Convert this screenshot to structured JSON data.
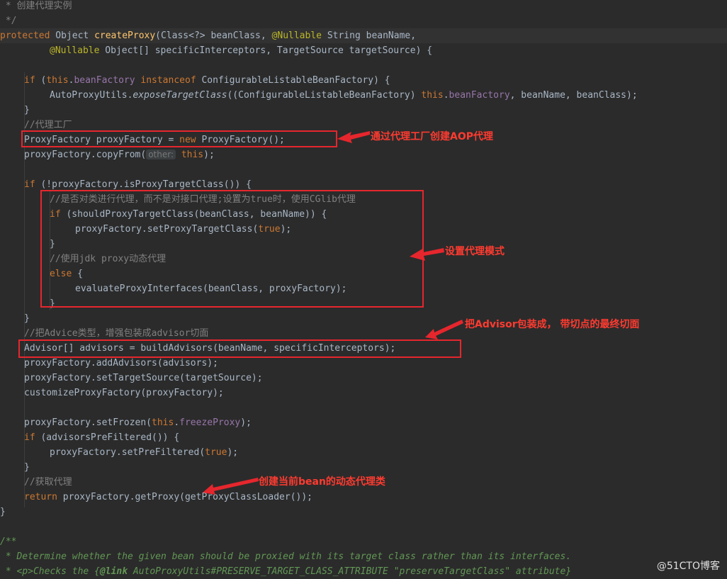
{
  "code": {
    "l1_comment": " * 创建代理实例",
    "l2_comment": " */",
    "l3_protected": "protected",
    "l3_object": " Object ",
    "l3_fn": "createProxy",
    "l3_rest1": "(Class<?> beanClass, ",
    "l3_ann": "@Nullable",
    "l3_rest2": " String beanName,",
    "l4_ann": "@Nullable",
    "l4_rest": " Object[] specificInterceptors, TargetSource targetSource) {",
    "l5_if": "if",
    "l5_a": " (",
    "l5_this": "this",
    "l5_dot": ".",
    "l5_field": "beanFactory",
    "l5_sp": " ",
    "l5_instanceof": "instanceof",
    "l5_rest": " ConfigurableListableBeanFactory) {",
    "l6_a": "AutoProxyUtils.",
    "l6_method": "exposeTargetClass",
    "l6_b": "((ConfigurableListableBeanFactory) ",
    "l6_this": "this",
    "l6_dot": ".",
    "l6_field": "beanFactory",
    "l6_rest": ", beanName, beanClass);",
    "l7": "}",
    "l8_comment": "//代理工厂",
    "l9_a": "ProxyFactory proxyFactory = ",
    "l9_new": "new",
    "l9_rest": " ProxyFactory();",
    "l10_a": "proxyFactory.copyFrom(",
    "l10_hint": "other:",
    "l10_this": "this",
    "l10_rest": ");",
    "l12_if": "if",
    "l12_rest": " (!proxyFactory.isProxyTargetClass()) {",
    "l13_comment": "//是否对类进行代理，而不是对接口代理;设置为true时，使用CGlib代理",
    "l14_if": "if",
    "l14_rest": " (shouldProxyTargetClass(beanClass, beanName)) {",
    "l15_a": "proxyFactory.setProxyTargetClass(",
    "l15_true": "true",
    "l15_rest": ");",
    "l16": "}",
    "l17_comment": "//使用jdk proxy动态代理",
    "l18_else": "else",
    "l18_rest": " {",
    "l19": "evaluateProxyInterfaces(beanClass, proxyFactory);",
    "l20": "}",
    "l21": "}",
    "l22_comment": "//把Advice类型，增强包装成advisor切面",
    "l23": "Advisor[] advisors = buildAdvisors(beanName, specificInterceptors);",
    "l24": "proxyFactory.addAdvisors(advisors);",
    "l25": "proxyFactory.setTargetSource(targetSource);",
    "l26": "customizeProxyFactory(proxyFactory);",
    "l28_a": "proxyFactory.setFrozen(",
    "l28_this": "this",
    "l28_dot": ".",
    "l28_field": "freezeProxy",
    "l28_rest": ");",
    "l29_if": "if",
    "l29_rest": " (advisorsPreFiltered()) {",
    "l30_a": "proxyFactory.setPreFiltered(",
    "l30_true": "true",
    "l30_rest": ");",
    "l31": "}",
    "l32_comment": "//获取代理",
    "l33_return": "return",
    "l33_rest": " proxyFactory.getProxy(getProxyClassLoader());",
    "l34": "}",
    "l36_doc": "/**",
    "l37_doc": " * Determine whether the given bean should be proxied with its target class rather than its interfaces.",
    "l38_a": " * <p>Checks the {",
    "l38_link": "@link",
    "l38_b": " AutoProxyUtils#PRESERVE_TARGET_CLASS_ATTRIBUTE \"preserveTargetClass\" attribute}"
  },
  "annotations": {
    "note1": "通过代理工厂创建AOP代理",
    "note2": "设置代理模式",
    "note3": "把Advisor包装成， 带切点的最终切面",
    "note4": "创建当前bean的动态代理类",
    "color": "#e6262d"
  },
  "watermark": "@51CTO博客"
}
